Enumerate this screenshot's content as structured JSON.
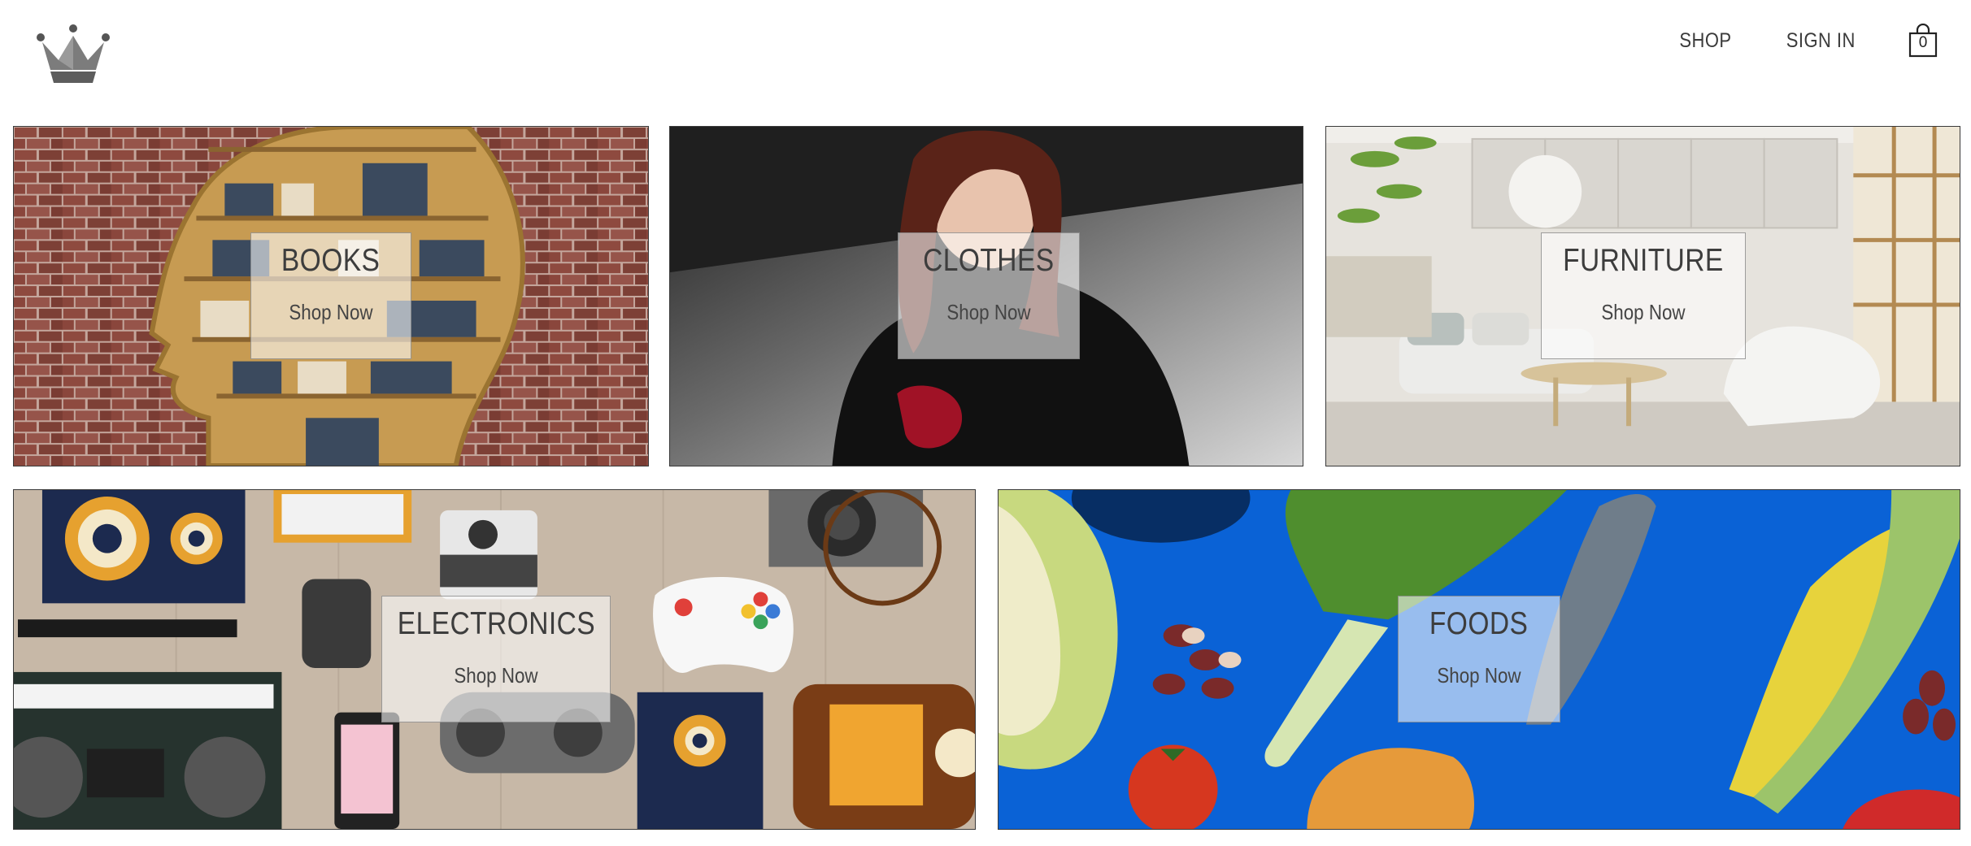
{
  "header": {
    "logo_icon": "crown-icon",
    "nav": {
      "shop_label": "SHOP",
      "signin_label": "SIGN IN"
    },
    "cart": {
      "icon": "shopping-bag-icon",
      "count": "0"
    }
  },
  "categories": [
    {
      "title": "BOOKS",
      "cta": "Shop Now"
    },
    {
      "title": "CLOTHES",
      "cta": "Shop Now"
    },
    {
      "title": "FURNITURE",
      "cta": "Shop Now"
    },
    {
      "title": "ELECTRONICS",
      "cta": "Shop Now"
    },
    {
      "title": "FOODS",
      "cta": "Shop Now"
    }
  ],
  "colors": {
    "label_box_bg": "#ffffff",
    "text": "#3d3d3d",
    "border": "#3a3a3a",
    "foods_bg": "#0a62d6",
    "books_brick": "#8c4a3e",
    "electronics_bg": "#c8b9a8"
  }
}
